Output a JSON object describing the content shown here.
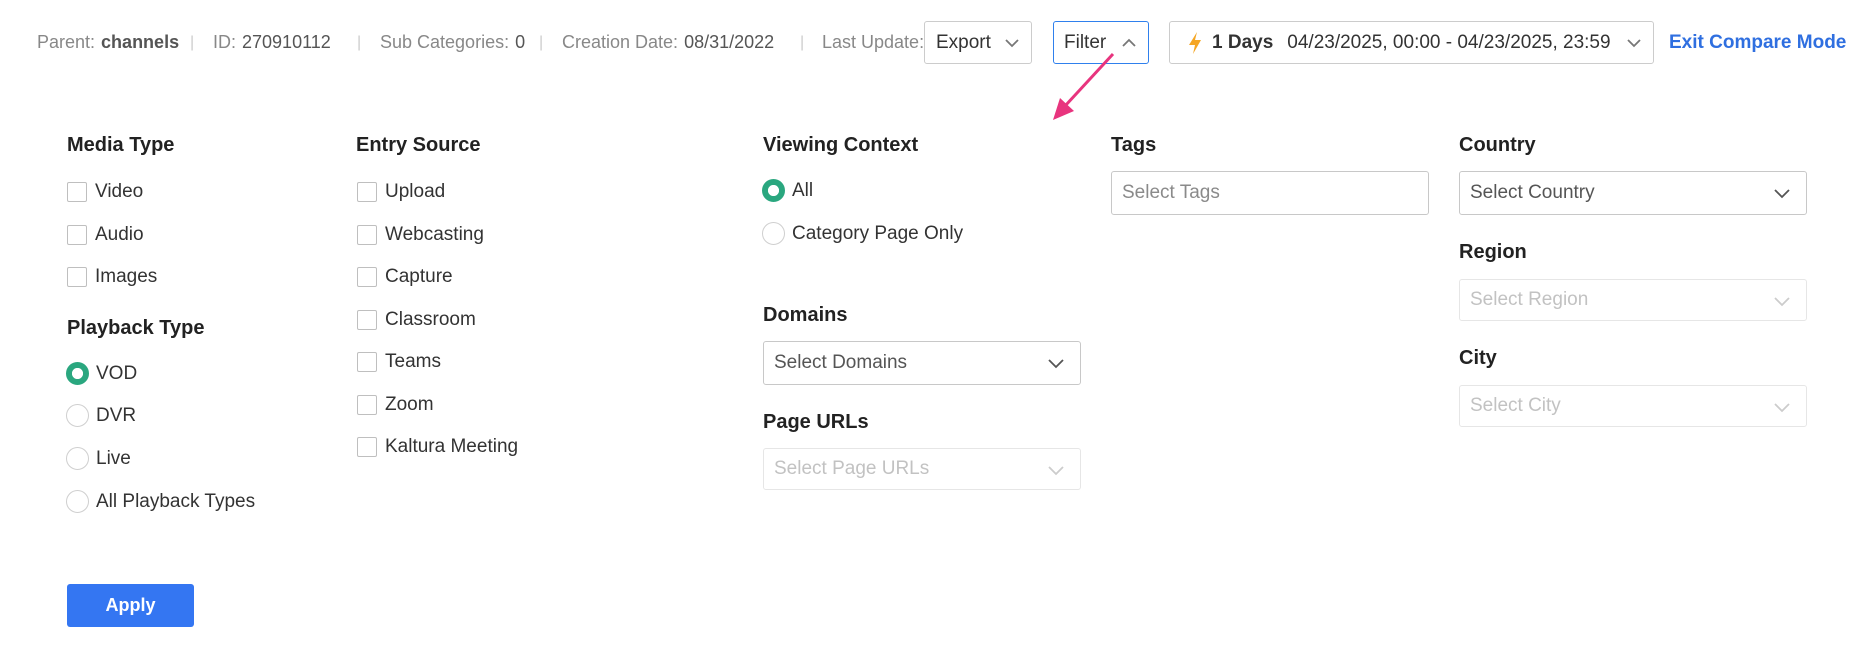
{
  "info": {
    "parent_label": "Parent:",
    "parent_value": "channels",
    "id_label": "ID:",
    "id_value": "270910112",
    "subcats_label": "Sub Categories:",
    "subcats_value": "0",
    "creation_label": "Creation Date:",
    "creation_value": "08/31/2022",
    "lastupdate_label": "Last Update:",
    "separator": "|"
  },
  "toolbar": {
    "export_label": "Export",
    "filter_label": "Filter",
    "days_label": "1 Days",
    "date_range": "04/23/2025, 00:00 - 04/23/2025, 23:59",
    "exit_compare_label": "Exit Compare Mode"
  },
  "filters": {
    "media_type": {
      "title": "Media Type",
      "options": [
        "Video",
        "Audio",
        "Images"
      ]
    },
    "playback_type": {
      "title": "Playback Type",
      "options": [
        "VOD",
        "DVR",
        "Live",
        "All Playback Types"
      ],
      "selected": "VOD"
    },
    "entry_source": {
      "title": "Entry Source",
      "options": [
        "Upload",
        "Webcasting",
        "Capture",
        "Classroom",
        "Teams",
        "Zoom",
        "Kaltura Meeting"
      ]
    },
    "viewing_context": {
      "title": "Viewing Context",
      "options": [
        "All",
        "Category Page Only"
      ],
      "selected": "All"
    },
    "domains": {
      "title": "Domains",
      "placeholder": "Select Domains"
    },
    "page_urls": {
      "title": "Page URLs",
      "placeholder": "Select Page URLs"
    },
    "tags": {
      "title": "Tags",
      "placeholder": "Select Tags"
    },
    "country": {
      "title": "Country",
      "placeholder": "Select Country"
    },
    "region": {
      "title": "Region",
      "placeholder": "Select Region"
    },
    "city": {
      "title": "City",
      "placeholder": "Select City"
    },
    "apply_label": "Apply"
  },
  "colors": {
    "accent_blue": "#3476f2",
    "link_blue": "#2f6fe0",
    "radio_green": "#2aa77f",
    "annotation_pink": "#e8347e",
    "bolt_orange": "#f5a623"
  }
}
